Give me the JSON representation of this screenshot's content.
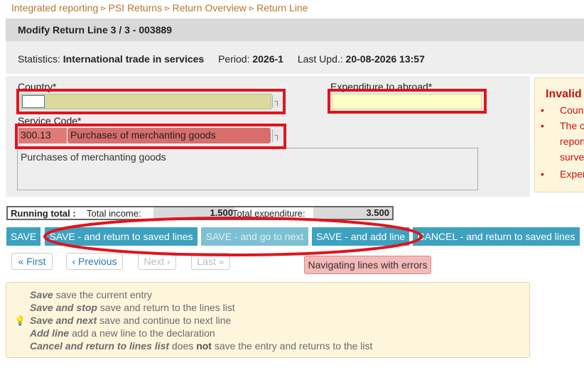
{
  "breadcrumb": [
    "Integrated reporting",
    "PSI Returns",
    "Return Overview",
    "Return Line"
  ],
  "breadcrumb_separator": "⊳",
  "title": "Modify Return Line 3 / 3 - 003889",
  "stats": {
    "statistics_label": "Statistics:",
    "statistics_value": "International trade in services",
    "period_label": "Period:",
    "period_value": "2026-1",
    "last_upd_label": "Last Upd.:",
    "last_upd_value": "20-08-2026 13:57"
  },
  "form": {
    "country_label": "Country*",
    "country_value": "",
    "expenditure_label": "Expenditure to abroad*",
    "expenditure_value": "",
    "service_code_label": "Service Code*",
    "service_code_value": "300.13",
    "service_code_desc": "Purchases of merchanting goods",
    "service_box_text": "Purchases of merchanting goods"
  },
  "invalid_panel": {
    "heading": "Invalid",
    "items": [
      "Count",
      "The c",
      "report",
      "survey",
      "Exper"
    ]
  },
  "running_total": {
    "label": "Running total :",
    "income_label": "Total income:",
    "income_value": "1.500",
    "expenditure_label": "Total expenditure:",
    "expenditure_value": "3.500"
  },
  "buttons": {
    "save": "SAVE",
    "save_return": "SAVE - and return to saved lines",
    "save_next": "SAVE - and go to next",
    "save_add": "SAVE - and add line",
    "cancel_return": "CANCEL - and return to saved lines"
  },
  "pager": {
    "first": "« First",
    "previous": "‹ Previous",
    "next": "Next ›",
    "last": "Last »"
  },
  "error_nav": "Navigating lines with errors",
  "help": [
    {
      "term": "Save",
      "text": " save the current entry"
    },
    {
      "term": "Save and stop",
      "text": " save and return to the lines list"
    },
    {
      "term": "Save and next",
      "text": " save and continue to next line"
    },
    {
      "term": "Add line",
      "text": " add a new line to the declaration"
    },
    {
      "term": "Cancel and return to lines list",
      "text": " does ",
      "bold": "not",
      "text2": " save the entry and returns to the list"
    }
  ],
  "colors": {
    "accent_button": "#3ca2bf",
    "breadcrumb": "#b8762b",
    "highlight_red": "#e0141e",
    "error_text": "#cc1111"
  },
  "icons": {
    "picker": "picker-icon",
    "bulb": "lightbulb-icon"
  }
}
